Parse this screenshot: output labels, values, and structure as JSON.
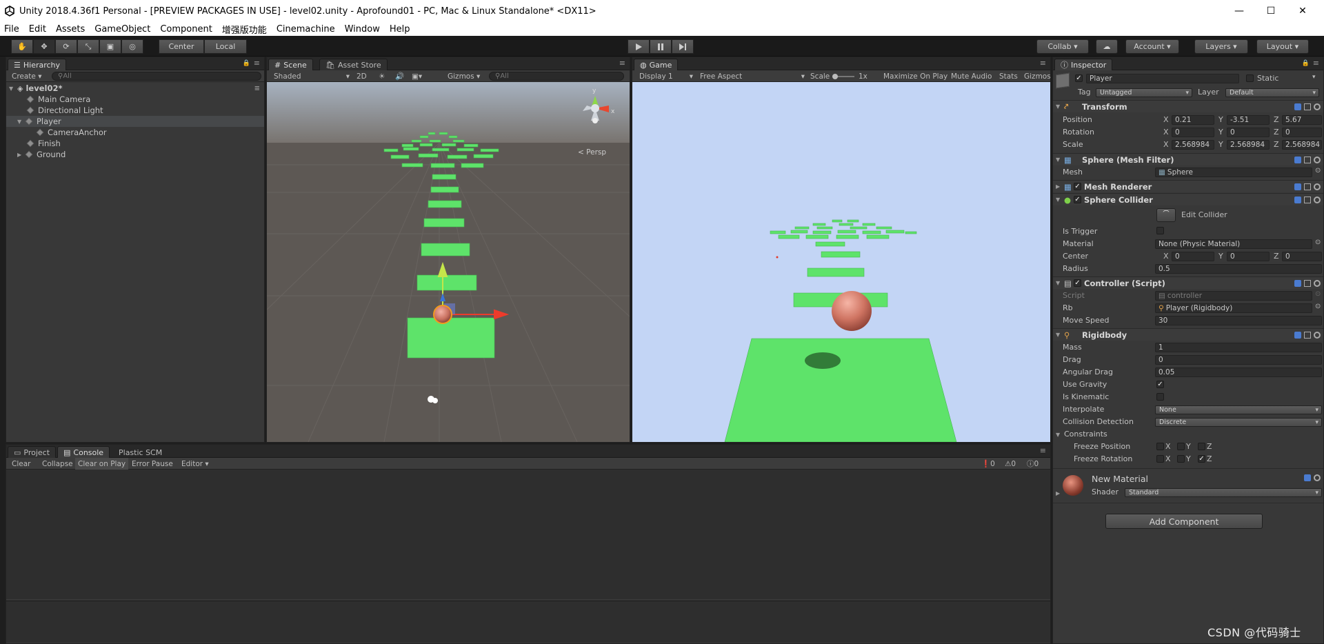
{
  "window": {
    "title": "Unity 2018.4.36f1 Personal - [PREVIEW PACKAGES IN USE] - level02.unity - Aprofound01 - PC, Mac & Linux Standalone* <DX11>",
    "minimize": "—",
    "maximize": "☐",
    "close": "✕"
  },
  "menu": [
    "File",
    "Edit",
    "Assets",
    "GameObject",
    "Component",
    "增强版功能",
    "Cinemachine",
    "Window",
    "Help"
  ],
  "toolbar": {
    "center": "Center",
    "local": "Local",
    "collab": "Collab ▾",
    "account": "Account",
    "layers": "Layers",
    "layout": "Layout"
  },
  "hierarchy": {
    "tab": "Hierarchy",
    "create": "Create",
    "search_placeholder": "All",
    "scene": "level02*",
    "items": [
      {
        "label": "Main Camera",
        "indent": 1
      },
      {
        "label": "Directional Light",
        "indent": 1
      },
      {
        "label": "Player",
        "indent": 1,
        "selected": true,
        "expanded": true
      },
      {
        "label": "CameraAnchor",
        "indent": 2
      },
      {
        "label": "Finish",
        "indent": 1
      },
      {
        "label": "Ground",
        "indent": 1,
        "collapsed": true
      }
    ]
  },
  "scene_view": {
    "tabs": [
      "Scene",
      "Asset Store"
    ],
    "shading": "Shaded",
    "mode_2d": "2D",
    "gizmos": "Gizmos",
    "search_placeholder": "All",
    "persp": "Persp",
    "gizmo_y": "y",
    "gizmo_x": "x"
  },
  "game_view": {
    "tab": "Game",
    "display": "Display 1",
    "aspect": "Free Aspect",
    "scale_label": "Scale",
    "scale_value": "1x",
    "maximize": "Maximize On Play",
    "mute": "Mute Audio",
    "stats": "Stats",
    "gizmos": "Gizmos"
  },
  "console": {
    "tabs": [
      "Project",
      "Console",
      "Plastic SCM"
    ],
    "buttons": [
      "Clear",
      "Collapse",
      "Clear on Play",
      "Error Pause",
      "Editor ▾"
    ],
    "counts": {
      "errors": "0",
      "warnings": "0",
      "logs": "0"
    }
  },
  "inspector": {
    "tab": "Inspector",
    "object_name": "Player",
    "static_label": "Static",
    "tag_label": "Tag",
    "tag_value": "Untagged",
    "layer_label": "Layer",
    "layer_value": "Default",
    "transform": {
      "title": "Transform",
      "position_label": "Position",
      "rotation_label": "Rotation",
      "scale_label": "Scale",
      "position": {
        "x": "0.21",
        "y": "-3.51",
        "z": "5.67"
      },
      "rotation": {
        "x": "0",
        "y": "0",
        "z": "0"
      },
      "scale": {
        "x": "2.568984",
        "y": "2.568984",
        "z": "2.568984"
      }
    },
    "mesh_filter": {
      "title": "Sphere (Mesh Filter)",
      "mesh_label": "Mesh",
      "mesh_value": "Sphere"
    },
    "mesh_renderer": {
      "title": "Mesh Renderer"
    },
    "sphere_collider": {
      "title": "Sphere Collider",
      "edit_collider": "Edit Collider",
      "is_trigger": "Is Trigger",
      "material_label": "Material",
      "material_value": "None (Physic Material)",
      "center_label": "Center",
      "center": {
        "x": "0",
        "y": "0",
        "z": "0"
      },
      "radius_label": "Radius",
      "radius": "0.5"
    },
    "controller": {
      "title": "Controller (Script)",
      "script_label": "Script",
      "script_value": "controller",
      "rb_label": "Rb",
      "rb_value": "Player (Rigidbody)",
      "move_speed_label": "Move Speed",
      "move_speed": "30"
    },
    "rigidbody": {
      "title": "Rigidbody",
      "mass_label": "Mass",
      "mass": "1",
      "drag_label": "Drag",
      "drag": "0",
      "angular_drag_label": "Angular Drag",
      "angular_drag": "0.05",
      "use_gravity": "Use Gravity",
      "is_kinematic": "Is Kinematic",
      "interpolate_label": "Interpolate",
      "interpolate": "None",
      "collision_label": "Collision Detection",
      "collision": "Discrete",
      "constraints": "Constraints",
      "freeze_position": "Freeze Position",
      "freeze_rotation": "Freeze Rotation",
      "axis_x": "X",
      "axis_y": "Y",
      "axis_z": "Z"
    },
    "material": {
      "name": "New Material",
      "shader_label": "Shader",
      "shader_value": "Standard"
    },
    "add_component": "Add Component"
  },
  "watermark": "CSDN @代码骑士",
  "colors": {
    "platform": "#5ee36a",
    "sky": "#c3d5f5",
    "ball": "#c86a5a",
    "scene_bg": "#5d5854"
  }
}
